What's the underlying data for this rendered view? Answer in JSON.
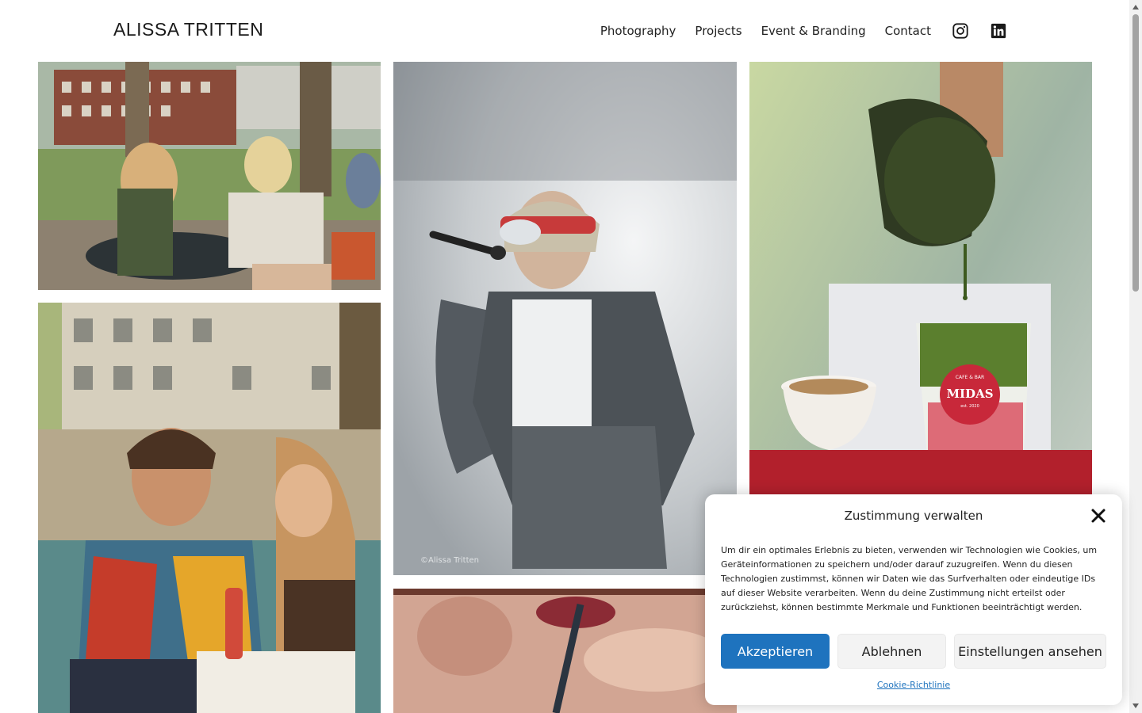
{
  "site": {
    "logo": "ALISSA TRITTEN"
  },
  "nav": {
    "items": [
      {
        "label": "Photography"
      },
      {
        "label": "Projects"
      },
      {
        "label": "Event & Branding"
      },
      {
        "label": "Contact"
      }
    ],
    "social": [
      "instagram-icon",
      "linkedin-icon"
    ]
  },
  "gallery": {
    "photos": [
      {
        "name": "photo-cafe-terrace-couple"
      },
      {
        "name": "photo-singer-on-stage",
        "watermark": "©Alissa Tritten"
      },
      {
        "name": "photo-matcha-drink-pour",
        "cup_text_top": "CAFE & BAR",
        "cup_text_main": "MIDAS",
        "cup_text_bottom": "est. 2020"
      },
      {
        "name": "photo-laughing-man-and-woman"
      },
      {
        "name": "photo-lips-drinking-straw"
      }
    ]
  },
  "consent": {
    "title": "Zustimmung verwalten",
    "body": "Um dir ein optimales Erlebnis zu bieten, verwenden wir Technologien wie Cookies, um Geräteinformationen zu speichern und/oder darauf zuzugreifen. Wenn du diesen Technologien zustimmst, können wir Daten wie das Surfverhalten oder eindeutige IDs auf dieser Website verarbeiten. Wenn du deine Zustimmung nicht erteilst oder zurückziehst, können bestimmte Merkmale und Funktionen beeinträchtigt werden.",
    "accept_label": "Akzeptieren",
    "deny_label": "Ablehnen",
    "settings_label": "Einstellungen ansehen",
    "policy_label": "Cookie-Richtlinie"
  },
  "colors": {
    "accent": "#1e73be",
    "text": "#222222",
    "background": "#ffffff"
  }
}
